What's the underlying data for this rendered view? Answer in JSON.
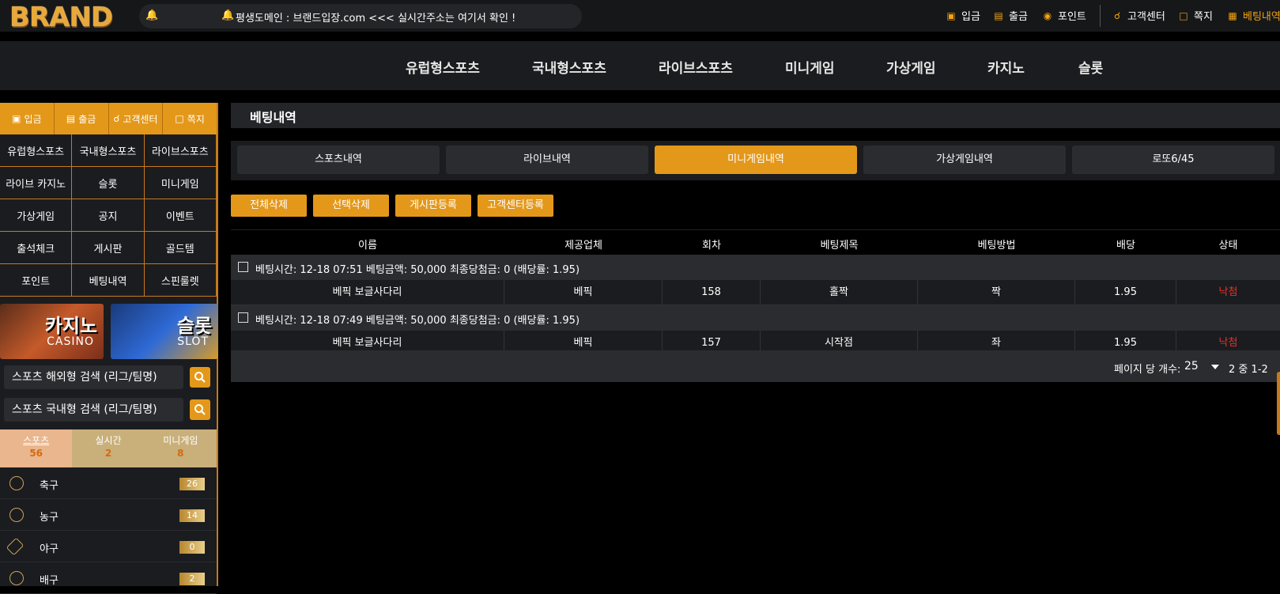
{
  "brand": {
    "logo": "BRAND"
  },
  "notice": {
    "text": "평생도메인 : 브랜드입장.com <<< 실시간주소는 여기서 확인 !"
  },
  "toplinks": {
    "deposit": "입금",
    "withdraw": "출금",
    "point": "포인트",
    "support": "고객센터",
    "message": "쪽지",
    "betting": "베팅내역"
  },
  "nav": [
    "유럽형스포츠",
    "국내형스포츠",
    "라이브스포츠",
    "미니게임",
    "가상게임",
    "카지노",
    "슬롯"
  ],
  "sidebar": {
    "quick": [
      "입금",
      "출금",
      "고객센터",
      "쪽지"
    ],
    "grid": [
      [
        "유럽형스포츠",
        "국내형스포츠",
        "라이브스포츠"
      ],
      [
        "라이브 카지노",
        "슬롯",
        "미니게임"
      ],
      [
        "가상게임",
        "공지",
        "이벤트"
      ],
      [
        "출석체크",
        "게시판",
        "골드템"
      ],
      [
        "포인트",
        "베팅내역",
        "스핀룰렛"
      ]
    ],
    "banner_casino": {
      "title": "카지노",
      "sub": "CASINO"
    },
    "banner_slot": {
      "title": "슬롯",
      "sub": "SLOT"
    },
    "search_foreign": "스포츠 해외형 검색 (리그/팀명)",
    "search_domestic": "스포츠 국내형 검색 (리그/팀명)",
    "sport_tabs": [
      {
        "label": "스포츠",
        "count": "56"
      },
      {
        "label": "실시간",
        "count": "2"
      },
      {
        "label": "미니게임",
        "count": "8"
      }
    ],
    "sports": [
      {
        "name": "축구",
        "count": "26"
      },
      {
        "name": "농구",
        "count": "14"
      },
      {
        "name": "야구",
        "count": "0"
      },
      {
        "name": "배구",
        "count": "2"
      }
    ]
  },
  "page": {
    "title": "베팅내역",
    "tabs": [
      "스포츠내역",
      "라이브내역",
      "미니게임내역",
      "가상게임내역",
      "로또6/45"
    ],
    "active_tab": "미니게임내역",
    "actions": [
      "전체삭제",
      "선택삭제",
      "게시판등록",
      "고객센터등록"
    ],
    "columns": [
      "이름",
      "제공업체",
      "회차",
      "베팅제목",
      "베팅방법",
      "배당",
      "상태"
    ],
    "bets": [
      {
        "header": "베팅시간:  12-18 07:51  베팅금액:  50,000  최종당첨금:  0  (배당률: 1.95)",
        "name": "베픽 보글사다리",
        "provider": "베픽",
        "round": "158",
        "title": "홀짝",
        "method": "짝",
        "odds": "1.95",
        "status": "낙첨"
      },
      {
        "header": "베팅시간:  12-18 07:49  베팅금액:  50,000  최종당첨금:  0  (배당률: 1.95)",
        "name": "베픽 보글사다리",
        "provider": "베픽",
        "round": "157",
        "title": "시작점",
        "method": "좌",
        "odds": "1.95",
        "status": "낙첨"
      }
    ],
    "pagination": {
      "per_page_label": "페이지 당 개수:",
      "per_page": "25",
      "range": "2 중 1-2"
    }
  }
}
